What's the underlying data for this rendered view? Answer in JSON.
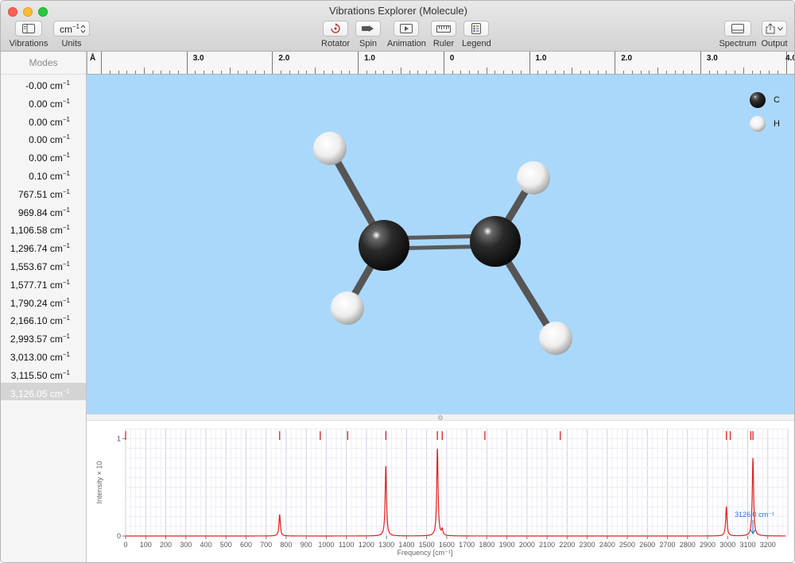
{
  "window": {
    "title": "Vibrations Explorer (Molecule)"
  },
  "toolbar": {
    "vibrations_label": "Vibrations",
    "units_value": "cm",
    "units_sup": "−1",
    "units_label": "Units",
    "rotator_label": "Rotator",
    "spin_label": "Spin",
    "animation_label": "Animation",
    "ruler_label": "Ruler",
    "legend_label": "Legend",
    "spectrum_label": "Spectrum",
    "output_label": "Output"
  },
  "ruler": {
    "unit": "Å",
    "labels": [
      "3.0",
      "2.0",
      "1.0",
      "0",
      "1.0",
      "2.0",
      "3.0",
      "4.0"
    ]
  },
  "sidebar": {
    "header": "Modes",
    "unit_base": "cm",
    "unit_sup": "−1",
    "modes": [
      "-0.00",
      "0.00",
      "0.00",
      "0.00",
      "0.00",
      "0.10",
      "767.51",
      "969.84",
      "1,106.58",
      "1,296.74",
      "1,553.67",
      "1,577.71",
      "1,790.24",
      "2,166.10",
      "2,993.57",
      "3,013.00",
      "3,115.50",
      "3,126.05"
    ],
    "selected_index": 17
  },
  "legend": {
    "items": [
      {
        "label": "C",
        "color": "#1c1c1c"
      },
      {
        "label": "H",
        "color": "#f2f2f2"
      }
    ]
  },
  "colors": {
    "carbon": "#1c1c1c",
    "hydrogen": "#f2f2f2",
    "bond": "#5a5a5a",
    "background": "#aad8fb",
    "spectrum_line": "#e02020",
    "marker": "#1a6fd6"
  },
  "chart_data": {
    "type": "line",
    "xlabel": "Frequency [cm⁻¹]",
    "ylabel": "Intensity × 10",
    "xlim": [
      0,
      3300
    ],
    "ylim": [
      0,
      1.1
    ],
    "x_ticks": [
      0,
      100,
      200,
      300,
      400,
      500,
      600,
      700,
      800,
      900,
      1000,
      1100,
      1200,
      1300,
      1400,
      1500,
      1600,
      1700,
      1800,
      1900,
      2000,
      2100,
      2200,
      2300,
      2400,
      2500,
      2600,
      2700,
      2800,
      2900,
      3000,
      3100,
      3200
    ],
    "y_ticks": [
      0,
      1
    ],
    "mode_markers": [
      0,
      767.51,
      969.84,
      1106.58,
      1296.74,
      1553.67,
      1577.71,
      1790.24,
      2166.1,
      2993.57,
      3013.0,
      3115.5,
      3126.05
    ],
    "peaks": [
      {
        "x": 767.51,
        "y": 0.22
      },
      {
        "x": 1296.74,
        "y": 0.72
      },
      {
        "x": 1553.67,
        "y": 0.9
      },
      {
        "x": 1577.71,
        "y": 0.06
      },
      {
        "x": 2993.57,
        "y": 0.3
      },
      {
        "x": 3126.05,
        "y": 0.8
      }
    ],
    "annotation": {
      "x": 3126.0,
      "text": "3126.0 cm⁻¹"
    }
  }
}
